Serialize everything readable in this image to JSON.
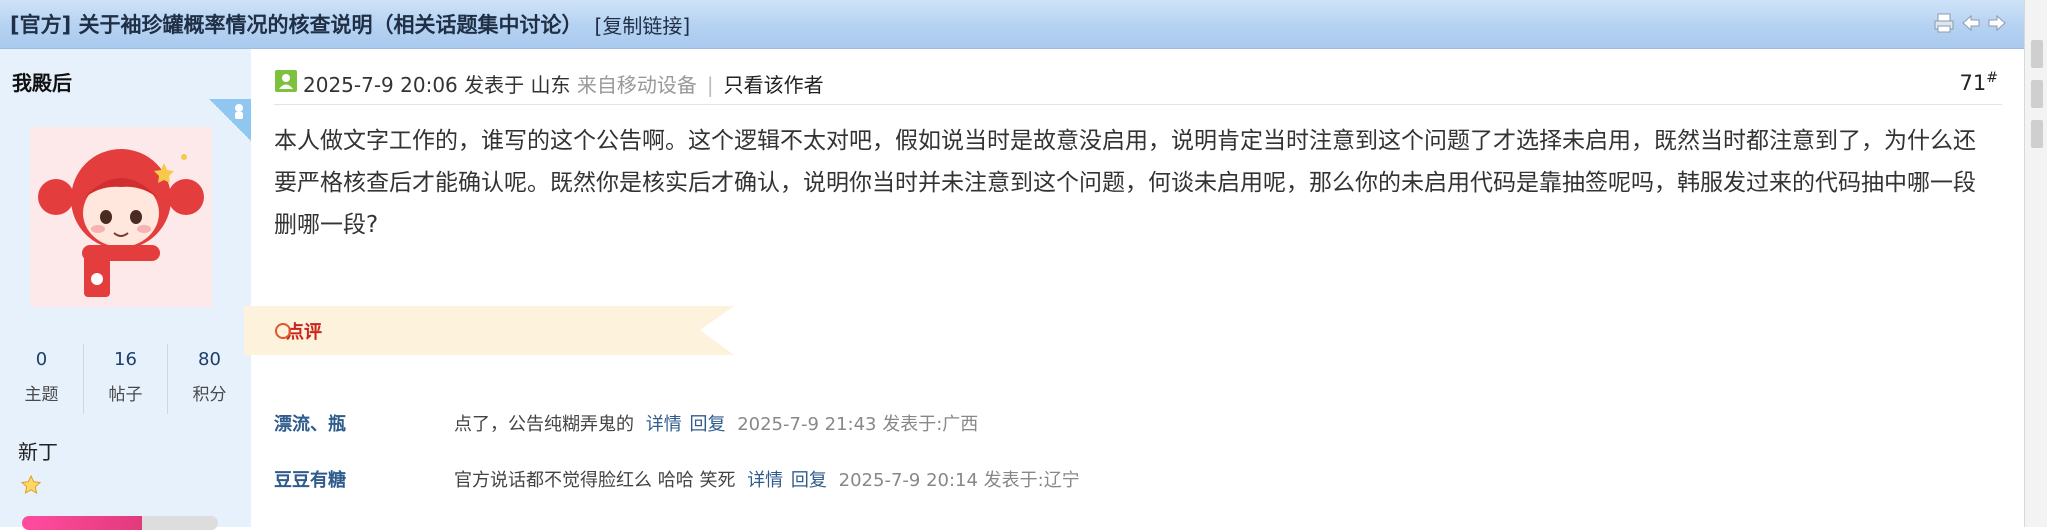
{
  "thread": {
    "title": "[官方] 关于袖珍罐概率情况的核查说明（相关话题集中讨论）",
    "copy_link": "[复制链接]"
  },
  "author": {
    "name": "我殿后",
    "stats": [
      {
        "value": "0",
        "label": "主题"
      },
      {
        "value": "16",
        "label": "帖子"
      },
      {
        "value": "80",
        "label": "积分"
      }
    ],
    "rank_title": "新丁",
    "rank_progress": 0.61
  },
  "post": {
    "date": "2025-7-9 20:06 发表于 山东",
    "source": "来自移动设备",
    "separator": "|",
    "only_author": "只看该作者",
    "floor": "71",
    "floor_mark": "#",
    "body": "本人做文字工作的，谁写的这个公告啊。这个逻辑不太对吧，假如说当时是故意没启用，说明肯定当时注意到这个问题了才选择未启用，既然当时都注意到了，为什么还要严格核查后才能确认呢。既然你是核实后才确认，说明你当时并未注意到这个问题，何谈未启用呢，那么你的未启用代码是靠抽签呢吗，韩服发过来的代码抽中哪一段删哪一段?"
  },
  "comments_section": {
    "label": "点评",
    "items": [
      {
        "user": "漂流、瓶",
        "text": "点了，公告纯糊弄鬼的",
        "detail": "详情",
        "reply": "回复",
        "meta": "2025-7-9 21:43 发表于:广西"
      },
      {
        "user": "豆豆有糖",
        "text": "官方说话都不觉得脸红么 哈哈 笑死",
        "detail": "详情",
        "reply": "回复",
        "meta": "2025-7-9 20:14 发表于:辽宁"
      }
    ]
  },
  "colors": {
    "titlebar": "#b7d3f2",
    "sidebar": "#e6f1fc",
    "link": "#2f5c8c",
    "comment_accent": "#c8251d",
    "comment_tag_bg": "#fdf2dc"
  },
  "icons": [
    "print-icon",
    "prev-thread-icon",
    "next-thread-icon",
    "online-status-icon",
    "gender-badge-icon",
    "star-icon",
    "comment-ring-icon"
  ]
}
